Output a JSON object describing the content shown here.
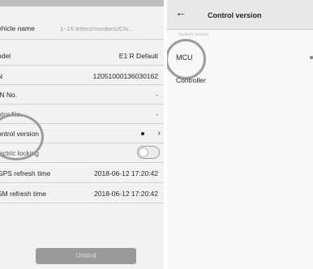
{
  "vehicle_detail": {
    "vehicle_name_label": "ehicle name",
    "vehicle_name_placeholder": "1~16 letters/numbers/Chi...",
    "model_label": "odel",
    "model_value": "E1 R Default",
    "sn_label": "N",
    "sn_value": "12051000136030162",
    "vin_label": "IN No.",
    "vin_value": "-",
    "motor_label": "otor No.",
    "motor_value": "-",
    "control_version_label": "ontrol version",
    "electric_locking_label": "lectric locking",
    "electric_locking_on": false,
    "gps_label": "GPS refresh time",
    "gps_value": "2018-06-12 17:20:42",
    "gsm_label": "SM refresh time",
    "gsm_value": "2018-06-12 17:20:42",
    "unbind_label": "Unbind"
  },
  "control_version": {
    "back_icon": "arrow-left-icon",
    "title": "Control version",
    "section_label": "System version",
    "items": [
      "MCU",
      "Controller"
    ]
  }
}
